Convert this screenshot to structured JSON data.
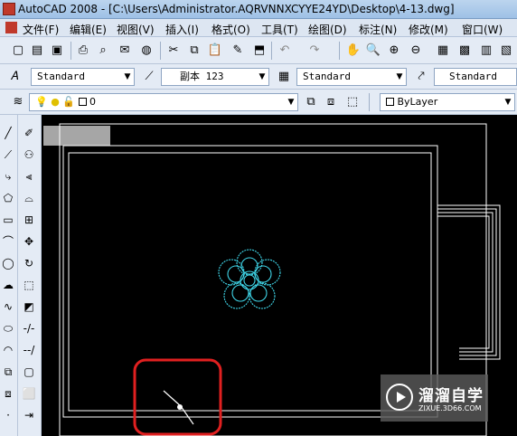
{
  "window": {
    "title": "AutoCAD 2008 - [C:\\Users\\Administrator.AQRVNNXCYYE24YD\\Desktop\\4-13.dwg]"
  },
  "menu": {
    "items": [
      "文件(F)",
      "编辑(E)",
      "视图(V)",
      "插入(I)",
      "格式(O)",
      "工具(T)",
      "绘图(D)",
      "标注(N)",
      "修改(M)",
      "窗口(W)"
    ]
  },
  "styles_toolbar": {
    "text_style": "Standard",
    "dim_style": "副本 123",
    "table_style": "Standard",
    "multileader_style": "Standard"
  },
  "layers_toolbar": {
    "current_layer": "0",
    "color_control": "ByLayer"
  },
  "watermark": {
    "title": "溜溜自学",
    "url": "ZIXUE.3D66.COM"
  },
  "colors": {
    "drawing_white": "#ffffff",
    "flower_cyan": "#3fd5e8",
    "highlight_red": "#e02020",
    "ui_background": "#e4ebf5"
  }
}
